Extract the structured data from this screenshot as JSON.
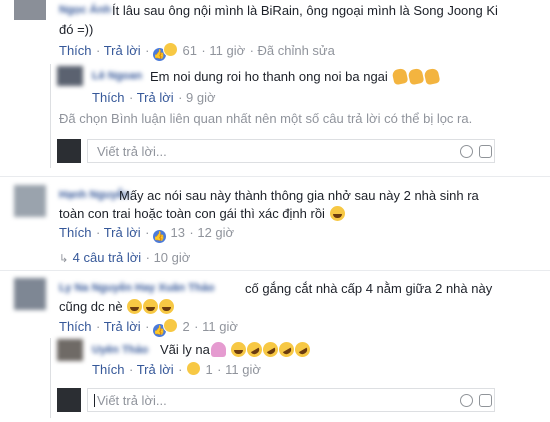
{
  "comment1": {
    "name": "Ngọc Ánh",
    "text_line1": "Ít lâu sau ông nội mình là BiRain, ông ngoại mình là Song Joong Ki",
    "text_line2": "đó =))",
    "like": "Thích",
    "reply": "Trả lời",
    "count": "61",
    "time": "11 giờ",
    "edited": "Đã chỉnh sửa"
  },
  "reply1": {
    "name": "Lê Ngoan",
    "text": "Em noi dung roi ho thanh ong noi ba ngai",
    "like": "Thích",
    "reply": "Trả lời",
    "time": "9 giờ"
  },
  "filter_note": "Đã chọn Bình luận liên quan nhất nên một số câu trả lời có thể bị lọc ra.",
  "reply_box1": {
    "placeholder": "Viết trả lời..."
  },
  "comment2": {
    "name": "Hạnh Nguyễn",
    "text_line1": "Mấy ac nói sau này thành thông gia nhở sau này 2 nhà sinh ra",
    "text_line2": "toàn con trai hoặc toàn con gái thì xác định rồi",
    "like": "Thích",
    "reply": "Trả lời",
    "count": "13",
    "time": "12 giờ"
  },
  "replies_link": {
    "label": "4 câu trả lời",
    "time": "10 giờ"
  },
  "comment3": {
    "name": "Ly Na Nguyễn Hay Xuân Thảo",
    "text_line1": "cố gắng cắt nhà cấp 4 nằm giữa 2 nhà này",
    "text_line2": "cũng dc nè",
    "like": "Thích",
    "reply": "Trả lời",
    "count": "2",
    "time": "11 giờ"
  },
  "reply3": {
    "name": "Uyên Thảo",
    "text": "Vãi ly na",
    "like": "Thích",
    "reply": "Trả lời",
    "count": "1",
    "time": "11 giờ"
  },
  "reply_box2": {
    "placeholder": "Viết trả lời..."
  },
  "colors": {
    "link": "#365899",
    "meta": "#90949c",
    "text": "#1d2129",
    "like_blue": "#4c7bd9"
  },
  "icons": [
    "like-icon",
    "haha-icon",
    "clap-emoji",
    "laugh-emoji",
    "rofl-emoji",
    "facepalm-emoji",
    "emoji-icon",
    "camera-icon",
    "reply-arrow-icon"
  ]
}
